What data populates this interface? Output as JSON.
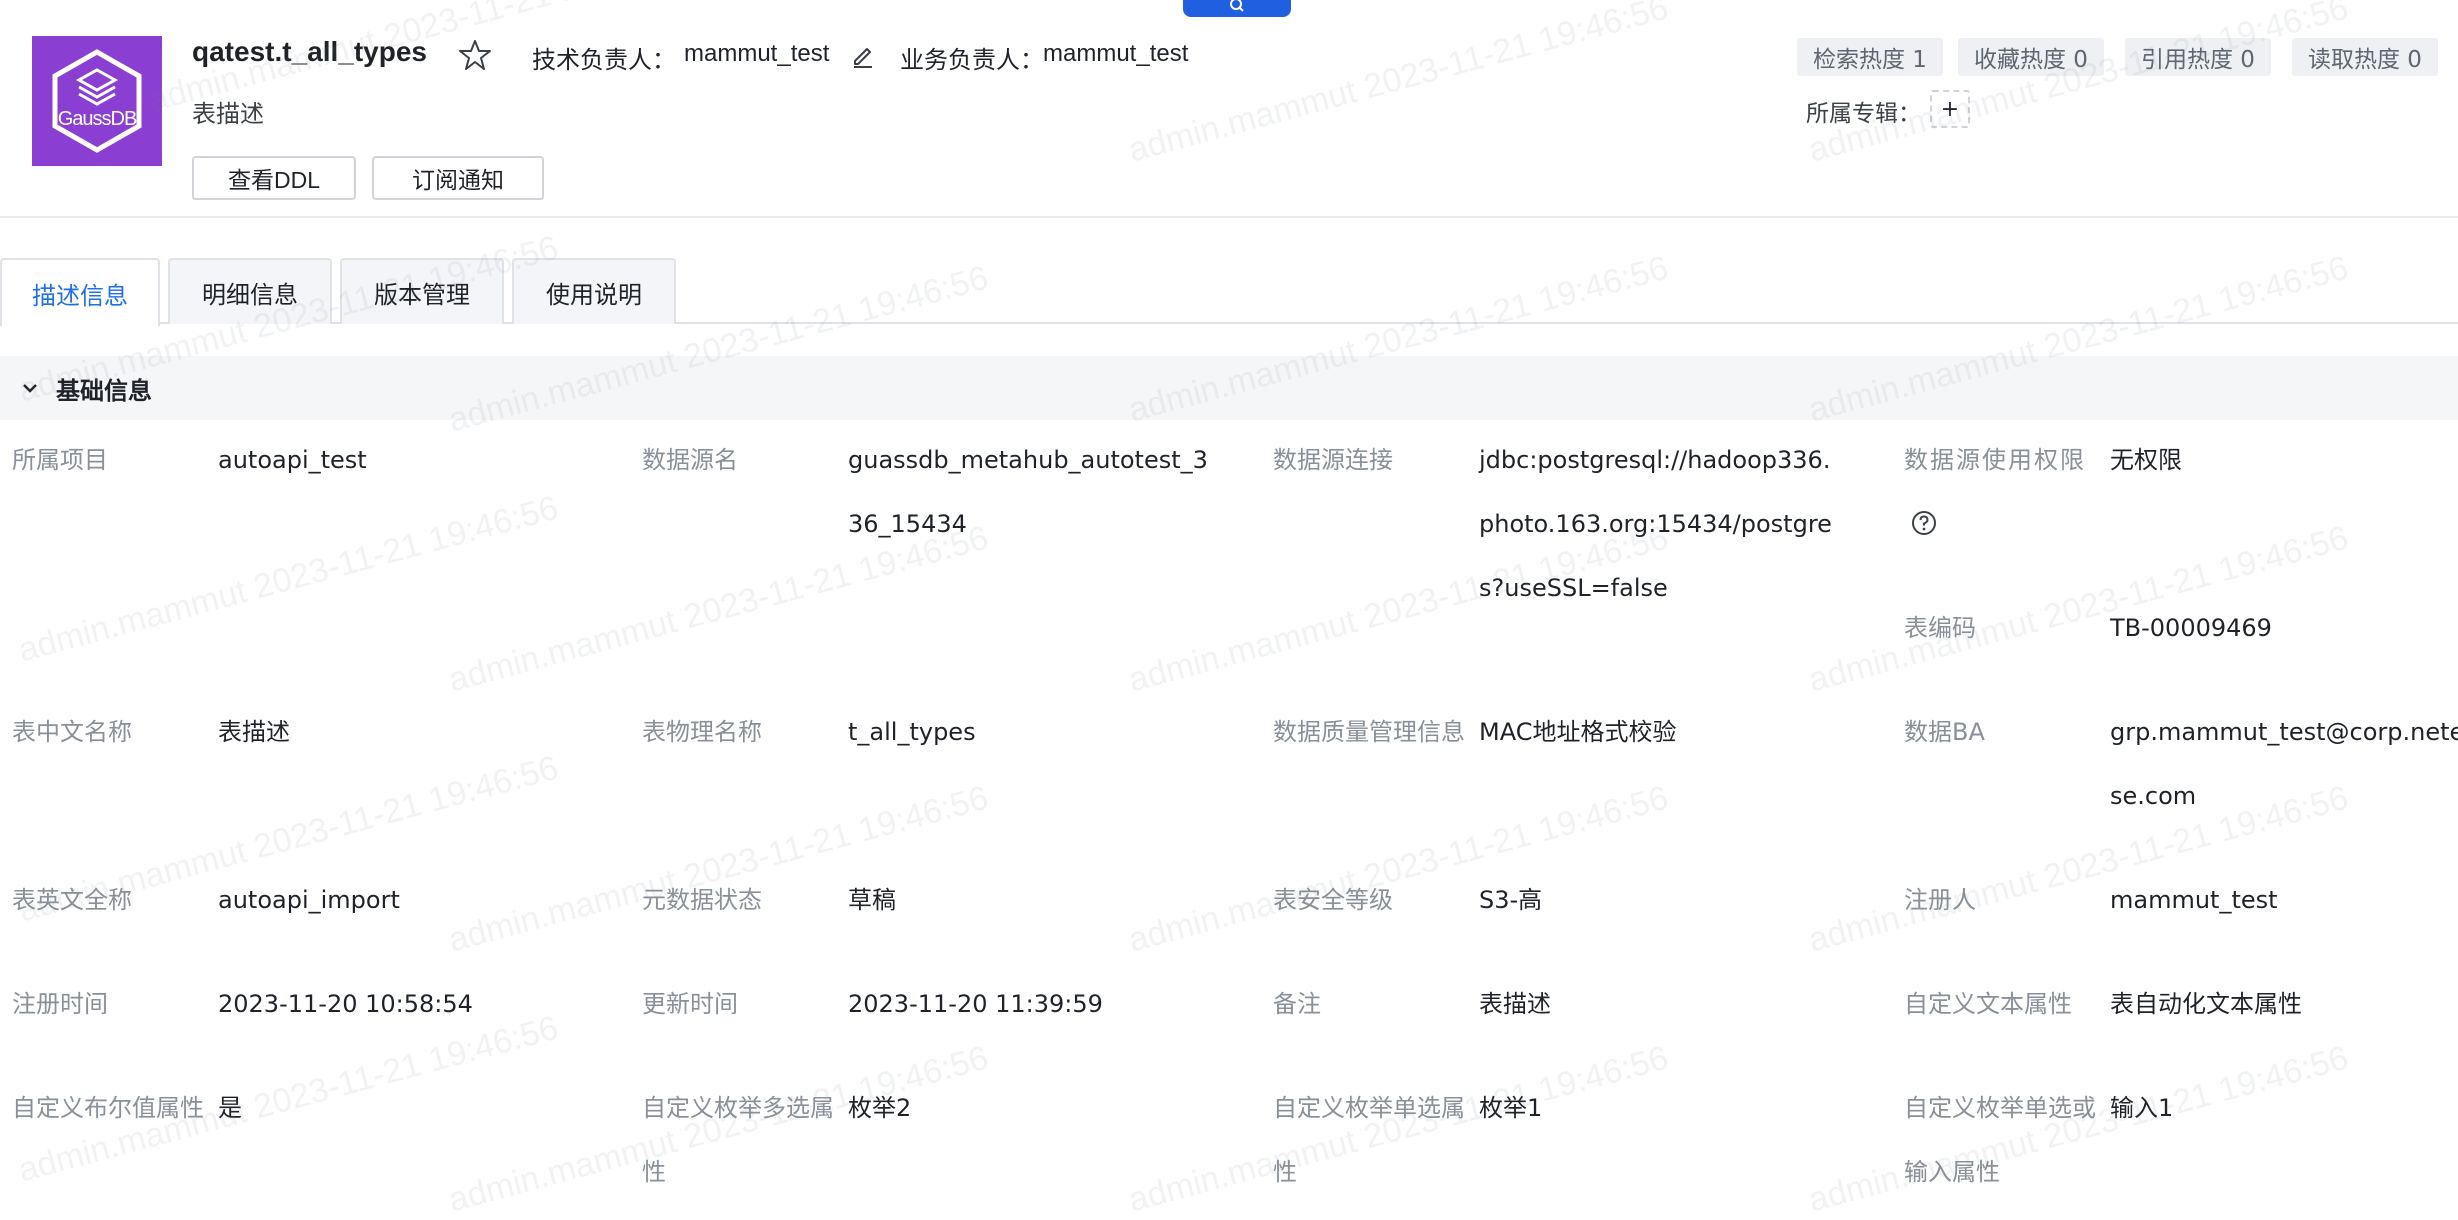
{
  "header": {
    "title": "qatest.t_all_types",
    "tech_owner_label": "技术负责人：",
    "tech_owner_value": "mammut_test",
    "biz_owner_label": "业务负责人：",
    "biz_owner_value": "mammut_test",
    "description": "表描述",
    "logo_text": "GaussDB",
    "buttons": {
      "view_ddl": "查看DDL",
      "subscribe": "订阅通知"
    },
    "heat": {
      "search": "检索热度 1",
      "favorite": "收藏热度 0",
      "reference": "引用热度 0",
      "read": "读取热度 0"
    },
    "album_label": "所属专辑：",
    "album_add": "+"
  },
  "tabs": [
    {
      "label": "描述信息",
      "active": true
    },
    {
      "label": "明细信息",
      "active": false
    },
    {
      "label": "版本管理",
      "active": false
    },
    {
      "label": "使用说明",
      "active": false
    }
  ],
  "section": {
    "title": "基础信息"
  },
  "fields": {
    "project": {
      "label": "所属项目",
      "value": "autoapi_test"
    },
    "datasource_name": {
      "label": "数据源名",
      "value_l1": "guassdb_metahub_autotest_3",
      "value_l2": "36_15434"
    },
    "datasource_conn": {
      "label": "数据源连接",
      "value_l1": "jdbc:postgresql://hadoop336.",
      "value_l2": "photo.163.org:15434/postgre",
      "value_l3": "s?useSSL=false"
    },
    "datasource_perm": {
      "label": "数据源使用权限",
      "value": "无权限"
    },
    "table_code": {
      "label": "表编码",
      "value": "TB-00009469"
    },
    "cn_name": {
      "label": "表中文名称",
      "value": "表描述"
    },
    "physical_name": {
      "label": "表物理名称",
      "value": "t_all_types"
    },
    "quality": {
      "label": "数据质量管理信息",
      "value": "MAC地址格式校验"
    },
    "data_ba": {
      "label": "数据BA",
      "value_l1": "grp.mammut_test@corp.netea",
      "value_l2": "se.com"
    },
    "en_name": {
      "label": "表英文全称",
      "value": "autoapi_import"
    },
    "meta_status": {
      "label": "元数据状态",
      "value": "草稿"
    },
    "security_level": {
      "label": "表安全等级",
      "value": "S3-高"
    },
    "registrant": {
      "label": "注册人",
      "value": "mammut_test"
    },
    "register_time": {
      "label": "注册时间",
      "value": "2023-11-20 10:58:54"
    },
    "update_time": {
      "label": "更新时间",
      "value": "2023-11-20 11:39:59"
    },
    "remark": {
      "label": "备注",
      "value": "表描述"
    },
    "custom_text": {
      "label": "自定义文本属性",
      "value": "表自动化文本属性"
    },
    "custom_bool": {
      "label": "自定义布尔值属性",
      "value": "是"
    },
    "custom_multi": {
      "label_l1": "自定义枚举多选属",
      "label_l2": "性",
      "value": "枚举2"
    },
    "custom_single": {
      "label_l1": "自定义枚举单选属",
      "label_l2": "性",
      "value": "枚举1"
    },
    "custom_single_input": {
      "label_l1": "自定义枚举单选或",
      "label_l2": "输入属性",
      "value": "输入1"
    }
  },
  "watermark": "admin.mammut 2023-11-21 19:46:56"
}
